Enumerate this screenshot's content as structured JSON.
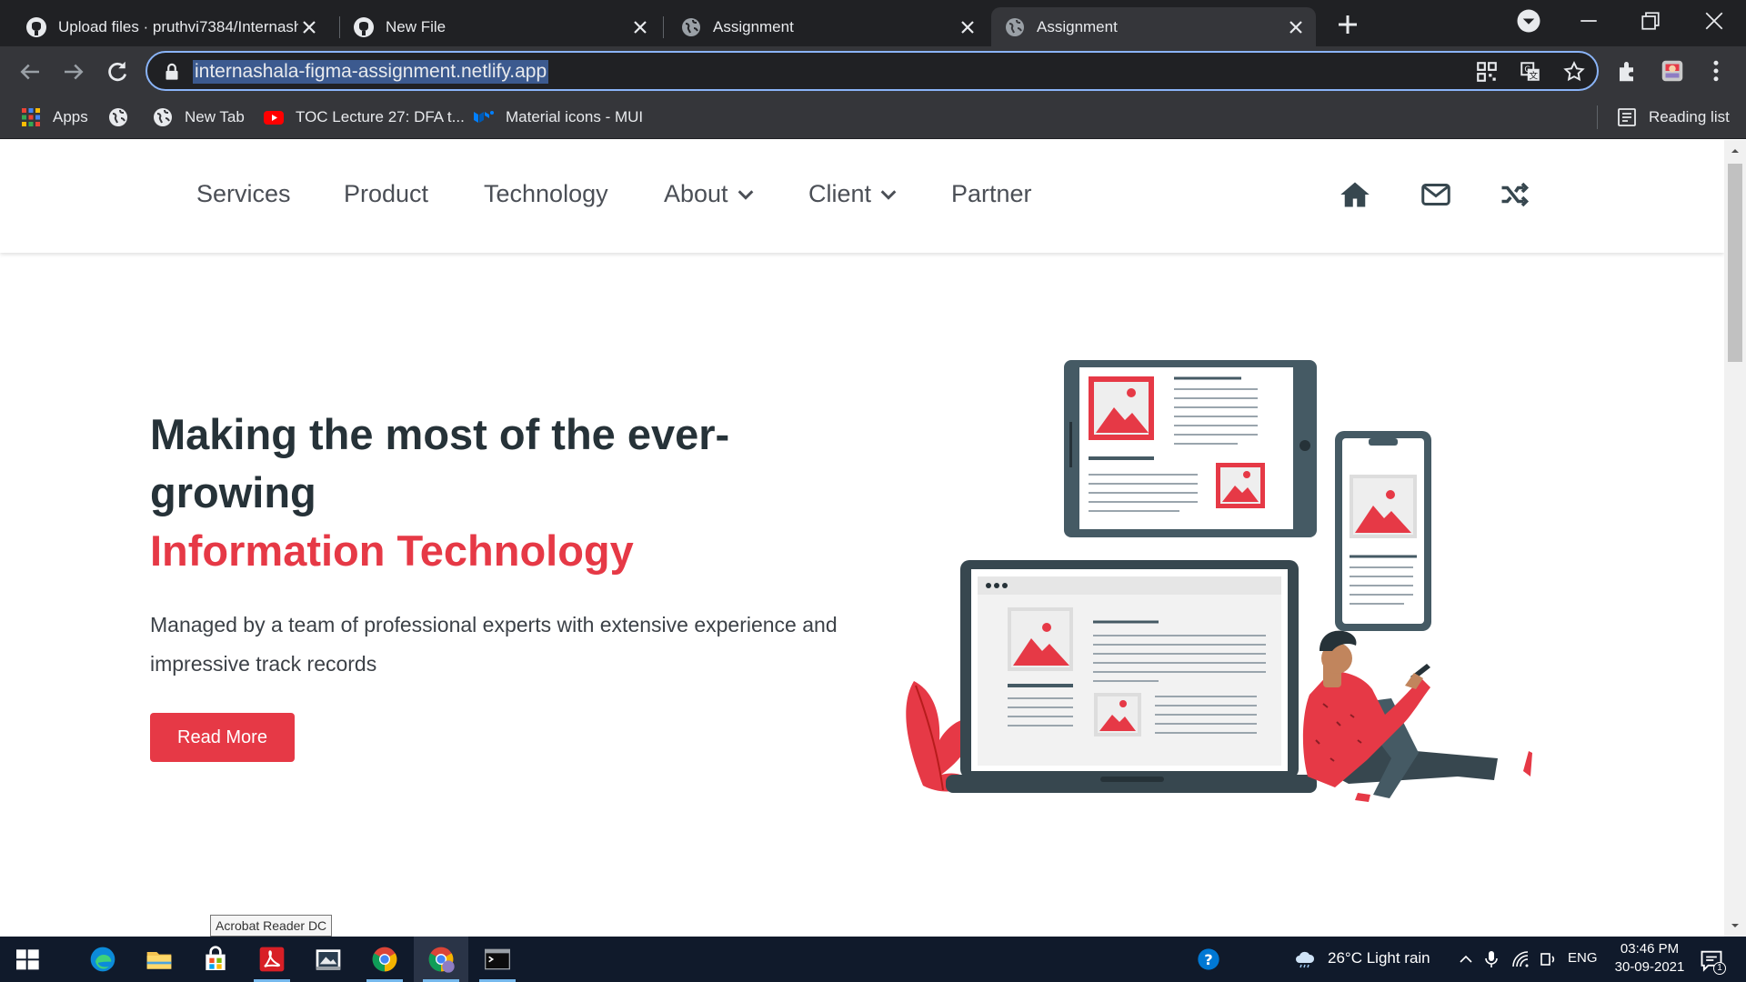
{
  "browser": {
    "tabs": [
      {
        "title": "Upload files · pruthvi7384/Internash",
        "icon": "github-icon",
        "active": false
      },
      {
        "title": "New File",
        "icon": "github-icon",
        "active": false
      },
      {
        "title": "Assignment",
        "icon": "globe-icon",
        "active": false
      },
      {
        "title": "Assignment",
        "icon": "globe-icon",
        "active": true
      }
    ],
    "url": "internashala-figma-assignment.netlify.app",
    "bookmarks": [
      {
        "label": "Apps",
        "icon": "apps-grid-icon"
      },
      {
        "label": "",
        "icon": "globe-icon"
      },
      {
        "label": "New Tab",
        "icon": "globe-icon"
      },
      {
        "label": "TOC Lecture 27: DFA t...",
        "icon": "youtube-icon"
      },
      {
        "label": "Material icons - MUI",
        "icon": "mui-logo-icon"
      }
    ],
    "reading_list": "Reading list"
  },
  "site": {
    "nav": {
      "items": [
        {
          "label": "Services",
          "dropdown": false
        },
        {
          "label": "Product",
          "dropdown": false
        },
        {
          "label": "Technology",
          "dropdown": false
        },
        {
          "label": "About",
          "dropdown": true
        },
        {
          "label": "Client",
          "dropdown": true
        },
        {
          "label": "Partner",
          "dropdown": false
        }
      ],
      "icons": [
        "home-icon",
        "mail-icon",
        "shuffle-icon"
      ]
    },
    "hero": {
      "heading_line1": "Making the most of the ever-growing",
      "heading_accent": "Information Technology",
      "description": "Managed by a team of professional experts with extensive experience and impressive track records",
      "button": "Read More"
    },
    "colors": {
      "accent": "#e63946",
      "dark": "#263238",
      "device": "#455a64"
    }
  },
  "tooltip": "Acrobat Reader DC",
  "taskbar": {
    "weather": "26°C  Light rain",
    "language": "ENG",
    "time": "03:46 PM",
    "date": "30-09-2021",
    "notification_count": "1"
  }
}
